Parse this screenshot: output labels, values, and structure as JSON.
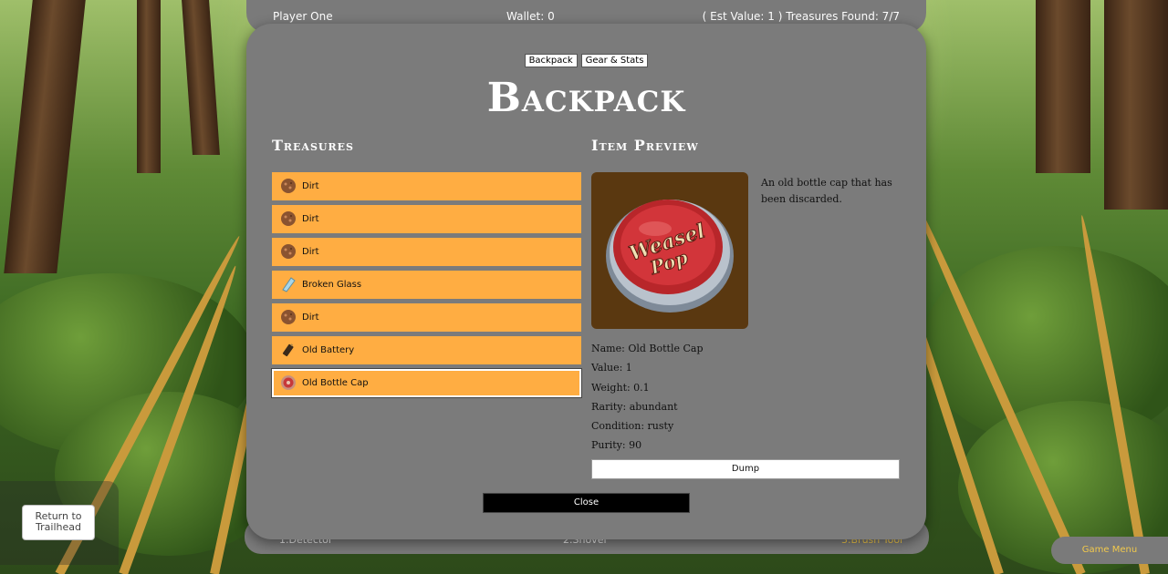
{
  "status_bar": {
    "player": "Player One",
    "wallet": "Wallet: 0",
    "treasures": "( Est Value: 1 ) Treasures Found: 7/7"
  },
  "toolbar": {
    "slot1": "1.Detector",
    "slot2": "2.Shovel",
    "slot3": "3.Brush Tool"
  },
  "modal": {
    "tabs": [
      "Backpack",
      "Gear & Stats"
    ],
    "title": "Backpack",
    "treasures_heading": "Treasures",
    "preview_heading": "Item Preview",
    "treasures": [
      {
        "label": "Dirt",
        "icon": "dirt-icon"
      },
      {
        "label": "Dirt",
        "icon": "dirt-icon"
      },
      {
        "label": "Dirt",
        "icon": "dirt-icon"
      },
      {
        "label": "Broken Glass",
        "icon": "glass-icon"
      },
      {
        "label": "Dirt",
        "icon": "dirt-icon"
      },
      {
        "label": "Old Battery",
        "icon": "battery-icon"
      },
      {
        "label": "Old Bottle Cap",
        "icon": "bottle-cap-icon",
        "selected": true
      }
    ],
    "preview": {
      "image_text_line1": "Weasel",
      "image_text_line2": "Pop",
      "description": "An old bottle cap that has been discarded.",
      "name": "Name: Old Bottle Cap",
      "value": "Value: 1",
      "weight": "Weight: 0.1",
      "rarity": "Rarity: abundant",
      "condition": "Condition: rusty",
      "purity": "Purity: 90"
    },
    "dump_label": "Dump",
    "close_label": "Close"
  },
  "return_label": "Return to Trailhead",
  "game_menu_label": "Game Menu",
  "colors": {
    "item_bg": "#ffad42",
    "panel": "#7b7b7b",
    "accent_yellow": "#f2c94c"
  }
}
